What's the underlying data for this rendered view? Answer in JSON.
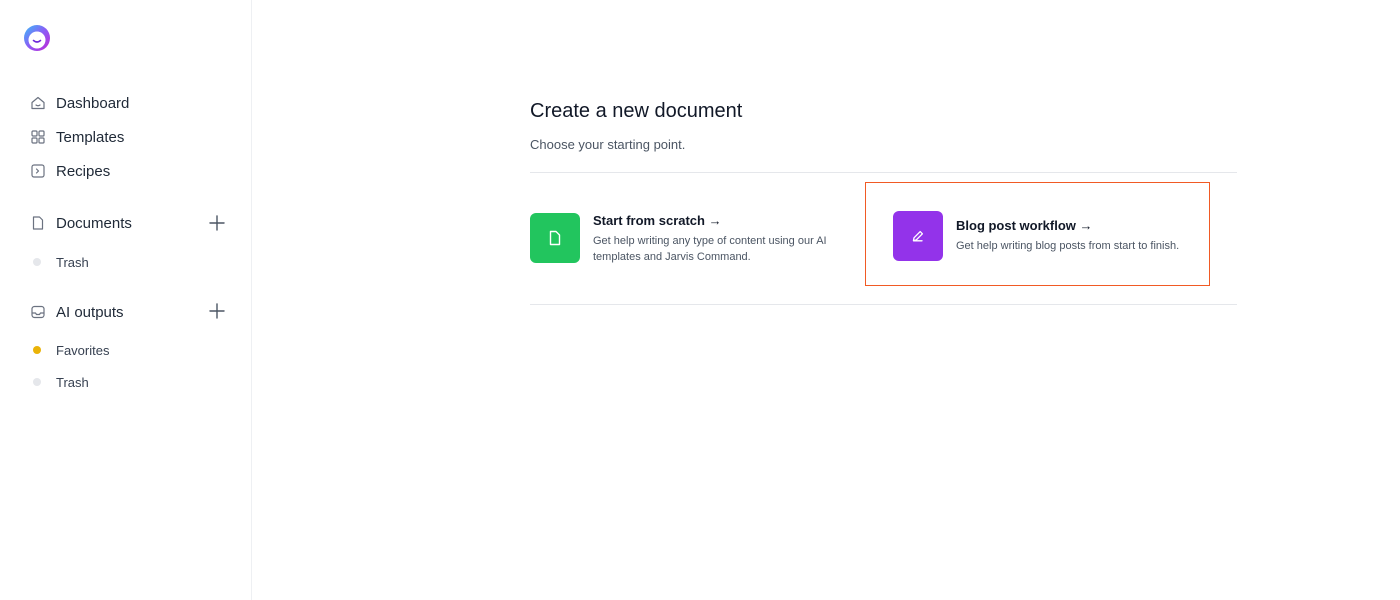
{
  "sidebar": {
    "logo_icon": "jasper-face-logo",
    "nav": [
      {
        "label": "Dashboard",
        "icon": "home-icon"
      },
      {
        "label": "Templates",
        "icon": "grid-icon"
      },
      {
        "label": "Recipes",
        "icon": "terminal-icon"
      }
    ],
    "documents": {
      "label": "Documents",
      "icon": "document-icon",
      "add_icon": "plus-icon",
      "items": [
        {
          "label": "Trash",
          "dot_color": "#e5e7eb"
        }
      ]
    },
    "ai_outputs": {
      "label": "AI outputs",
      "icon": "inbox-icon",
      "add_icon": "plus-icon",
      "items": [
        {
          "label": "Favorites",
          "dot_color": "#eab308"
        },
        {
          "label": "Trash",
          "dot_color": "#e5e7eb"
        }
      ]
    }
  },
  "main": {
    "title": "Create a new document",
    "subtitle": "Choose your starting point.",
    "options": [
      {
        "title": "Start from scratch →",
        "description_line1": "Get help writing any type of content using our AI",
        "description_line2": "templates and Jarvis Command.",
        "icon": "file-icon",
        "color": "#22c55e"
      },
      {
        "title": "Blog post workflow →",
        "description_line1": "Get help writing blog posts from start to finish.",
        "icon": "pencil-icon",
        "color": "#9333ea",
        "highlight_color": "#f15a24"
      }
    ]
  }
}
